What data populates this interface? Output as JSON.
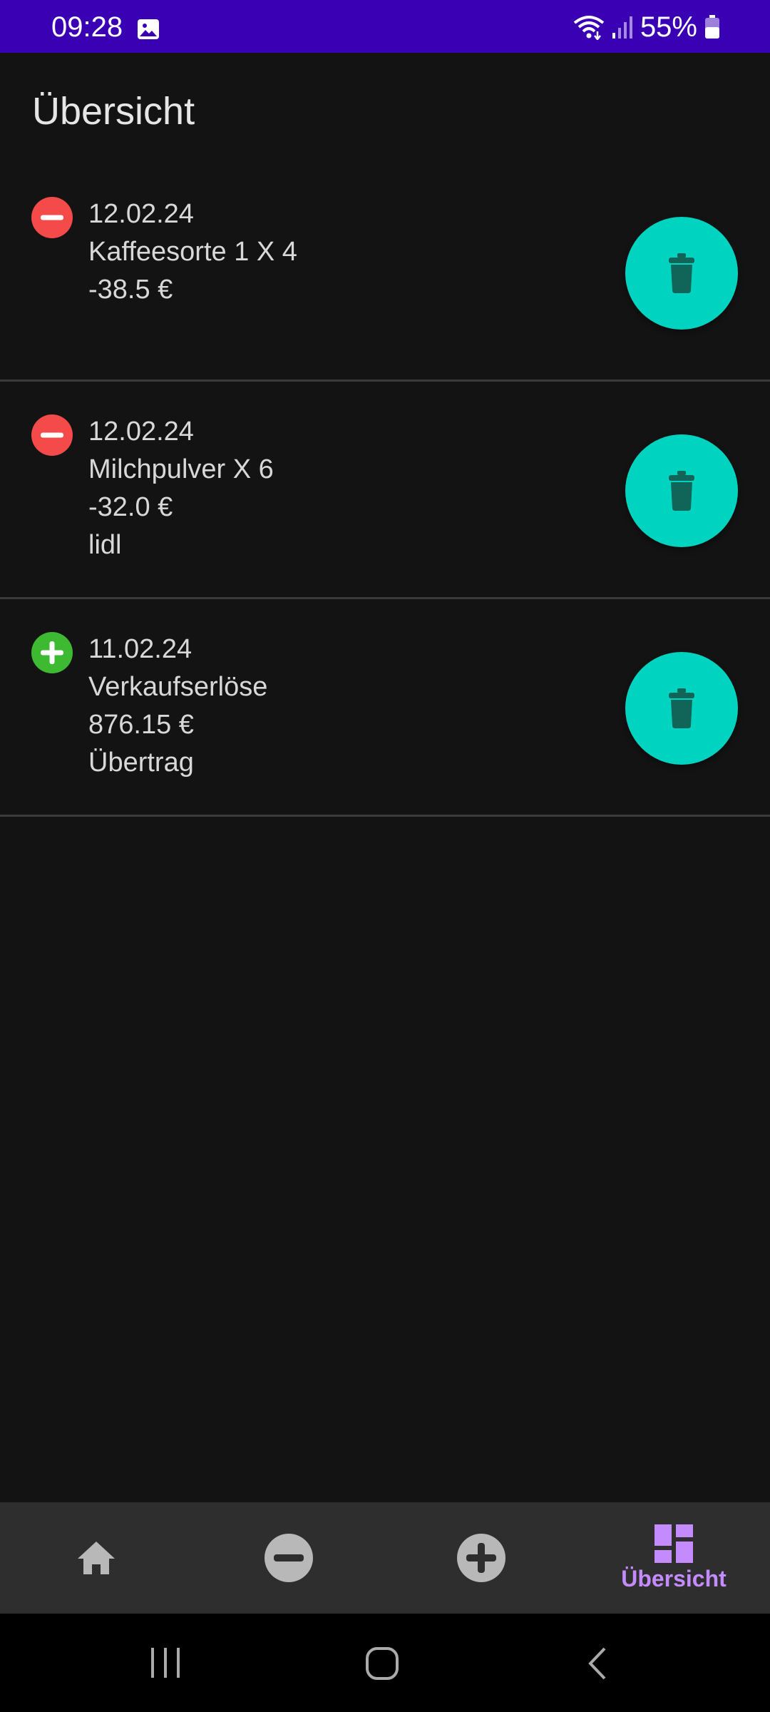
{
  "status_bar": {
    "time": "09:28",
    "battery": "55%"
  },
  "page": {
    "title": "Übersicht"
  },
  "entries": [
    {
      "type": "expense",
      "date": "12.02.24",
      "item": "Kaffeesorte 1 X 4",
      "amount": "-38.5 €",
      "note": ""
    },
    {
      "type": "expense",
      "date": "12.02.24",
      "item": "Milchpulver X 6",
      "amount": "-32.0 €",
      "note": "lidl"
    },
    {
      "type": "income",
      "date": "11.02.24",
      "item": "Verkaufserlöse",
      "amount": "876.15 €",
      "note": "Übertrag"
    }
  ],
  "bottom_nav": {
    "items": [
      {
        "icon": "home-icon",
        "label": ""
      },
      {
        "icon": "minus-circle-icon",
        "label": ""
      },
      {
        "icon": "plus-circle-icon",
        "label": ""
      },
      {
        "icon": "dashboard-icon",
        "label": "Übersicht",
        "active": true
      }
    ]
  },
  "colors": {
    "status_bar": "#3a00b4",
    "background": "#131313",
    "delete_button": "#00d4c0",
    "expense": "#f44a4a",
    "income": "#3dba32",
    "nav_active": "#c48bff",
    "nav_inactive": "#b8b8b8"
  }
}
